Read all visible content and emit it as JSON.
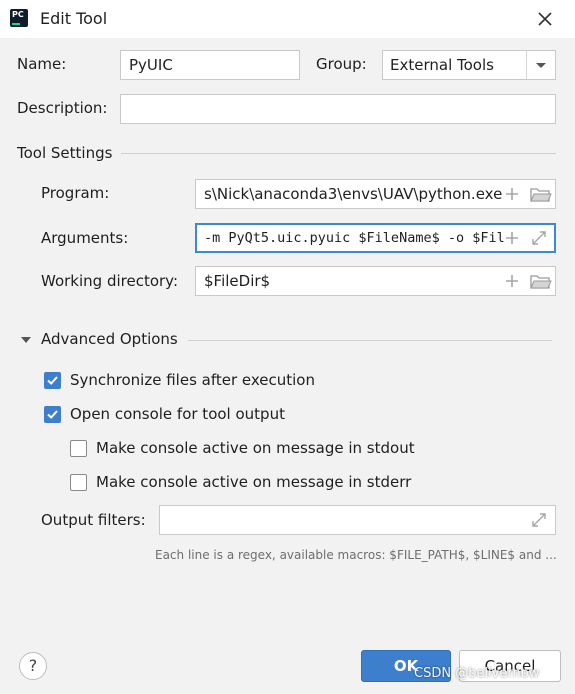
{
  "window": {
    "title": "Edit Tool",
    "app_icon": "pycharm-logo",
    "close_icon": "close-icon"
  },
  "form": {
    "name_label": "Name:",
    "name_value": "PyUIC",
    "group_label": "Group:",
    "group_value": "External Tools",
    "description_label": "Description:",
    "description_value": ""
  },
  "tool_settings": {
    "heading": "Tool Settings",
    "program_label": "Program:",
    "program_value": "s\\Nick\\anaconda3\\envs\\UAV\\python.exe",
    "arguments_label": "Arguments:",
    "arguments_value": "-m PyQt5.uic.pyuic $FileName$ -o $Fil",
    "working_dir_label": "Working directory:",
    "working_dir_value": "$FileDir$"
  },
  "advanced": {
    "heading": "Advanced Options",
    "expanded": true,
    "options": [
      {
        "label": "Synchronize files after execution",
        "checked": true
      },
      {
        "label": "Open console for tool output",
        "checked": true
      },
      {
        "label": "Make console active on message in stdout",
        "checked": false
      },
      {
        "label": "Make console active on message in stderr",
        "checked": false
      }
    ],
    "output_filters_label": "Output filters:",
    "output_filters_value": "",
    "hint": "Each line is a regex, available macros: $FILE_PATH$, $LINE$ and ..."
  },
  "buttons": {
    "help": "?",
    "ok": "OK",
    "cancel": "Cancel"
  },
  "watermark": "CSDN @belivernow",
  "colors": {
    "accent": "#3d7fcc",
    "focus_border": "#3d88d5",
    "background": "#f2f2f2"
  }
}
